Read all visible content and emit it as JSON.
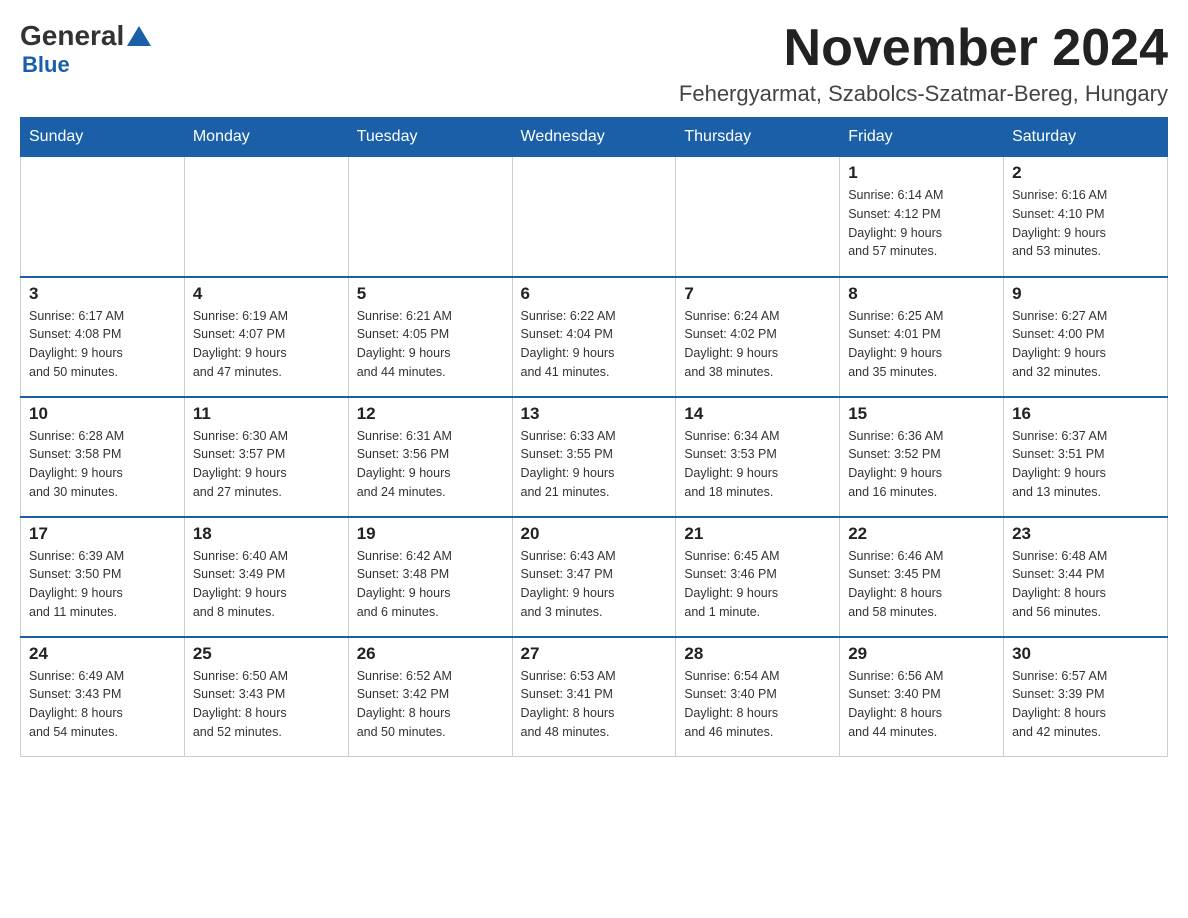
{
  "header": {
    "month_title": "November 2024",
    "location": "Fehergyarmat, Szabolcs-Szatmar-Bereg, Hungary",
    "logo": {
      "general": "General",
      "blue": "Blue"
    }
  },
  "weekdays": [
    "Sunday",
    "Monday",
    "Tuesday",
    "Wednesday",
    "Thursday",
    "Friday",
    "Saturday"
  ],
  "weeks": [
    {
      "days": [
        {
          "number": "",
          "info": ""
        },
        {
          "number": "",
          "info": ""
        },
        {
          "number": "",
          "info": ""
        },
        {
          "number": "",
          "info": ""
        },
        {
          "number": "",
          "info": ""
        },
        {
          "number": "1",
          "info": "Sunrise: 6:14 AM\nSunset: 4:12 PM\nDaylight: 9 hours\nand 57 minutes."
        },
        {
          "number": "2",
          "info": "Sunrise: 6:16 AM\nSunset: 4:10 PM\nDaylight: 9 hours\nand 53 minutes."
        }
      ]
    },
    {
      "days": [
        {
          "number": "3",
          "info": "Sunrise: 6:17 AM\nSunset: 4:08 PM\nDaylight: 9 hours\nand 50 minutes."
        },
        {
          "number": "4",
          "info": "Sunrise: 6:19 AM\nSunset: 4:07 PM\nDaylight: 9 hours\nand 47 minutes."
        },
        {
          "number": "5",
          "info": "Sunrise: 6:21 AM\nSunset: 4:05 PM\nDaylight: 9 hours\nand 44 minutes."
        },
        {
          "number": "6",
          "info": "Sunrise: 6:22 AM\nSunset: 4:04 PM\nDaylight: 9 hours\nand 41 minutes."
        },
        {
          "number": "7",
          "info": "Sunrise: 6:24 AM\nSunset: 4:02 PM\nDaylight: 9 hours\nand 38 minutes."
        },
        {
          "number": "8",
          "info": "Sunrise: 6:25 AM\nSunset: 4:01 PM\nDaylight: 9 hours\nand 35 minutes."
        },
        {
          "number": "9",
          "info": "Sunrise: 6:27 AM\nSunset: 4:00 PM\nDaylight: 9 hours\nand 32 minutes."
        }
      ]
    },
    {
      "days": [
        {
          "number": "10",
          "info": "Sunrise: 6:28 AM\nSunset: 3:58 PM\nDaylight: 9 hours\nand 30 minutes."
        },
        {
          "number": "11",
          "info": "Sunrise: 6:30 AM\nSunset: 3:57 PM\nDaylight: 9 hours\nand 27 minutes."
        },
        {
          "number": "12",
          "info": "Sunrise: 6:31 AM\nSunset: 3:56 PM\nDaylight: 9 hours\nand 24 minutes."
        },
        {
          "number": "13",
          "info": "Sunrise: 6:33 AM\nSunset: 3:55 PM\nDaylight: 9 hours\nand 21 minutes."
        },
        {
          "number": "14",
          "info": "Sunrise: 6:34 AM\nSunset: 3:53 PM\nDaylight: 9 hours\nand 18 minutes."
        },
        {
          "number": "15",
          "info": "Sunrise: 6:36 AM\nSunset: 3:52 PM\nDaylight: 9 hours\nand 16 minutes."
        },
        {
          "number": "16",
          "info": "Sunrise: 6:37 AM\nSunset: 3:51 PM\nDaylight: 9 hours\nand 13 minutes."
        }
      ]
    },
    {
      "days": [
        {
          "number": "17",
          "info": "Sunrise: 6:39 AM\nSunset: 3:50 PM\nDaylight: 9 hours\nand 11 minutes."
        },
        {
          "number": "18",
          "info": "Sunrise: 6:40 AM\nSunset: 3:49 PM\nDaylight: 9 hours\nand 8 minutes."
        },
        {
          "number": "19",
          "info": "Sunrise: 6:42 AM\nSunset: 3:48 PM\nDaylight: 9 hours\nand 6 minutes."
        },
        {
          "number": "20",
          "info": "Sunrise: 6:43 AM\nSunset: 3:47 PM\nDaylight: 9 hours\nand 3 minutes."
        },
        {
          "number": "21",
          "info": "Sunrise: 6:45 AM\nSunset: 3:46 PM\nDaylight: 9 hours\nand 1 minute."
        },
        {
          "number": "22",
          "info": "Sunrise: 6:46 AM\nSunset: 3:45 PM\nDaylight: 8 hours\nand 58 minutes."
        },
        {
          "number": "23",
          "info": "Sunrise: 6:48 AM\nSunset: 3:44 PM\nDaylight: 8 hours\nand 56 minutes."
        }
      ]
    },
    {
      "days": [
        {
          "number": "24",
          "info": "Sunrise: 6:49 AM\nSunset: 3:43 PM\nDaylight: 8 hours\nand 54 minutes."
        },
        {
          "number": "25",
          "info": "Sunrise: 6:50 AM\nSunset: 3:43 PM\nDaylight: 8 hours\nand 52 minutes."
        },
        {
          "number": "26",
          "info": "Sunrise: 6:52 AM\nSunset: 3:42 PM\nDaylight: 8 hours\nand 50 minutes."
        },
        {
          "number": "27",
          "info": "Sunrise: 6:53 AM\nSunset: 3:41 PM\nDaylight: 8 hours\nand 48 minutes."
        },
        {
          "number": "28",
          "info": "Sunrise: 6:54 AM\nSunset: 3:40 PM\nDaylight: 8 hours\nand 46 minutes."
        },
        {
          "number": "29",
          "info": "Sunrise: 6:56 AM\nSunset: 3:40 PM\nDaylight: 8 hours\nand 44 minutes."
        },
        {
          "number": "30",
          "info": "Sunrise: 6:57 AM\nSunset: 3:39 PM\nDaylight: 8 hours\nand 42 minutes."
        }
      ]
    }
  ]
}
